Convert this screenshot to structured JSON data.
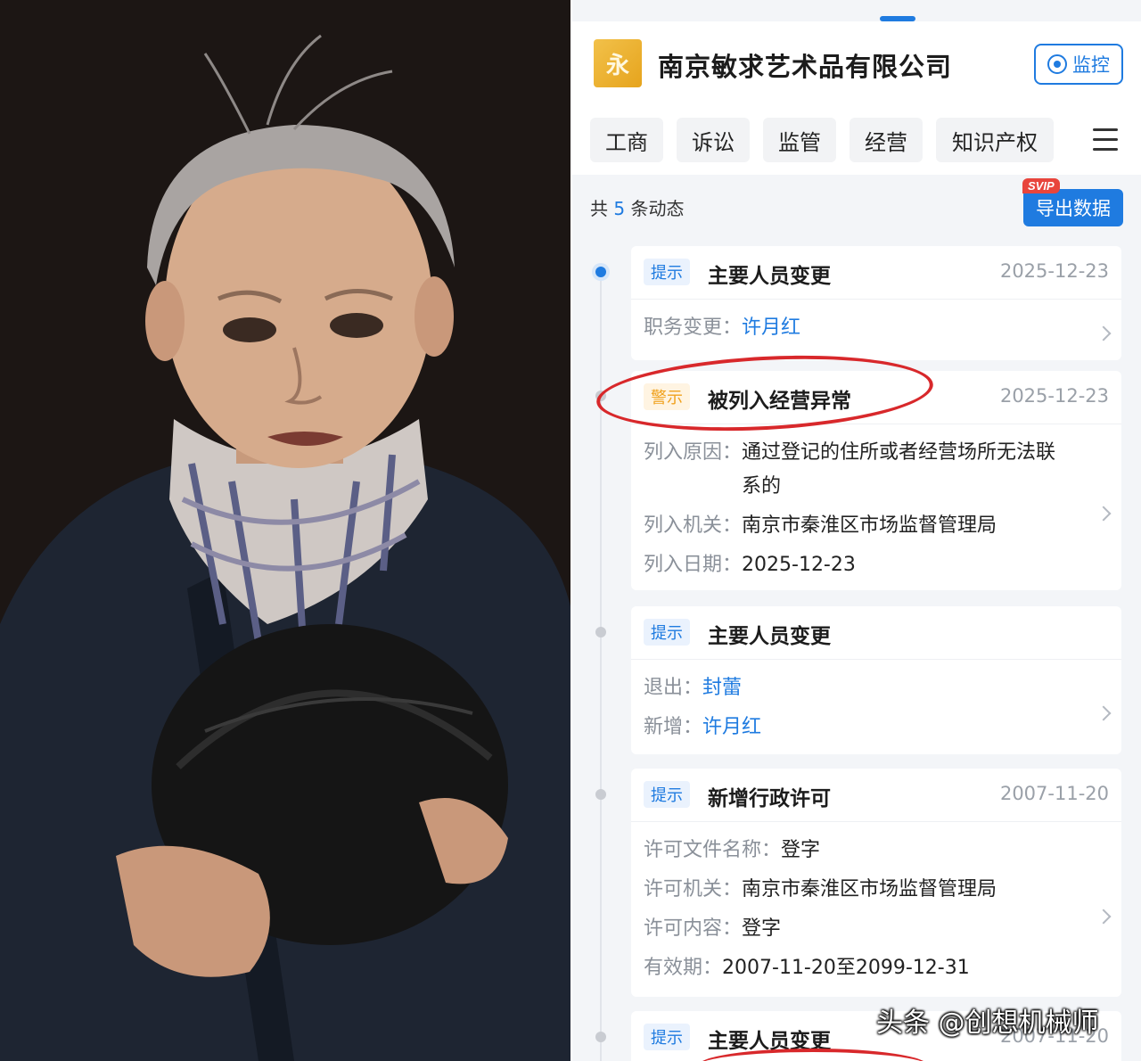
{
  "header": {
    "logo_glyph": "永",
    "company_name": "南京敏求艺术品有限公司",
    "monitor_label": "监控"
  },
  "tabs": [
    {
      "label": "工商"
    },
    {
      "label": "诉讼"
    },
    {
      "label": "监管"
    },
    {
      "label": "经营"
    },
    {
      "label": "知识产权"
    }
  ],
  "summary": {
    "prefix": "共",
    "count": "5",
    "suffix": "条动态",
    "svip_label": "SVIP",
    "export_label": "导出数据"
  },
  "events": [
    {
      "badge": "提示",
      "title": "主要人员变更",
      "date": "2025-12-23",
      "rows": [
        {
          "key": "职务变更：",
          "value": "许月红"
        }
      ]
    },
    {
      "badge": "警示",
      "title": "被列入经营异常",
      "date": "2025-12-23",
      "rows": [
        {
          "key": "列入原因：",
          "value": "通过登记的住所或者经营场所无法联系的"
        },
        {
          "key": "列入机关：",
          "value": "南京市秦淮区市场监督管理局"
        },
        {
          "key": "列入日期：",
          "value": "2025-12-23"
        }
      ]
    },
    {
      "badge": "提示",
      "title": "主要人员变更",
      "date": "",
      "rows": [
        {
          "key": "退出：",
          "value": "封蕾"
        },
        {
          "key": "新增：",
          "value": "许月红"
        }
      ]
    },
    {
      "badge": "提示",
      "title": "新增行政许可",
      "date": "2007-11-20",
      "rows": [
        {
          "key": "许可文件名称：",
          "value": "登字"
        },
        {
          "key": "许可机关：",
          "value": "南京市秦淮区市场监督管理局"
        },
        {
          "key": "许可内容：",
          "value": "登字"
        },
        {
          "key": "有效期：",
          "value": "2007-11-20至2099-12-31"
        }
      ]
    },
    {
      "badge": "提示",
      "title": "主要人员变更",
      "date": "2007-11-20",
      "rows": []
    }
  ],
  "watermark": "头条 @创想机械师",
  "colors": {
    "accent": "#1f7be0",
    "warn": "#f0a21f",
    "highlight": "#d8282b"
  }
}
